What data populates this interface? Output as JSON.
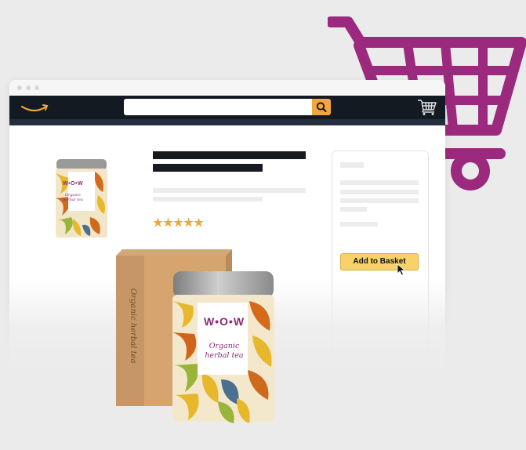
{
  "colors": {
    "cart": "#9b2a7e",
    "nav_bg": "#131a22",
    "subnav_bg": "#232f3e",
    "search_button": "#f2a73b",
    "add_button": "#f7d26a",
    "star": "#f2a73b",
    "brand": "#8c2a77"
  },
  "header": {
    "logo_icon": "smile-arrow-logo",
    "search": {
      "value": "",
      "placeholder": ""
    },
    "search_icon": "search-icon",
    "cart_icon": "shopping-cart-icon"
  },
  "product": {
    "brand": "W•O•W",
    "description": "Organic\nherbal tea",
    "box_text": "Organic herbal tea",
    "rating": 5,
    "rating_max": 5
  },
  "buybox": {
    "add_to_basket_label": "Add to Basket"
  }
}
